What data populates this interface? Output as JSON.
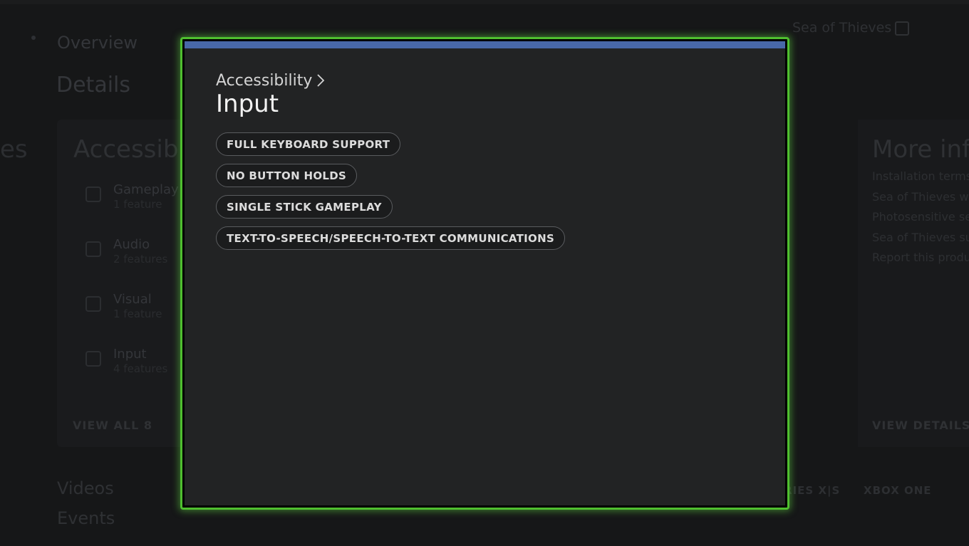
{
  "background": {
    "nav_overview": "Overview",
    "nav_details": "Details",
    "account_name": "Sea of Thieves",
    "accessibility_title": "Accessibility",
    "edge_text": "es",
    "items": [
      {
        "title": "Gameplay",
        "subtitle": "1 feature"
      },
      {
        "title": "Audio",
        "subtitle": "2 features"
      },
      {
        "title": "Visual",
        "subtitle": "1 feature"
      },
      {
        "title": "Input",
        "subtitle": "4 features"
      }
    ],
    "view_all": "VIEW ALL 8",
    "more_info_title": "More info",
    "more_info_links": [
      "Installation terms",
      "Sea of Thieves we",
      "Photosensitive se",
      "Sea of Thieves sup",
      "Report this produ"
    ],
    "view_details": "VIEW DETAILS",
    "videos": "Videos",
    "events": "Events",
    "platforms": [
      "XBOX SERIES X|S",
      "XBOX ONE"
    ]
  },
  "dialog": {
    "breadcrumb": "Accessibility",
    "title": "Input",
    "chips": [
      "FULL KEYBOARD SUPPORT",
      "NO BUTTON HOLDS",
      "SINGLE STICK GAMEPLAY",
      "TEXT-TO-SPEECH/SPEECH-TO-TEXT COMMUNICATIONS"
    ]
  },
  "colors": {
    "focus_border": "#4fbf2f",
    "accent_bar": "#4868a8",
    "dialog_bg": "#222324"
  }
}
